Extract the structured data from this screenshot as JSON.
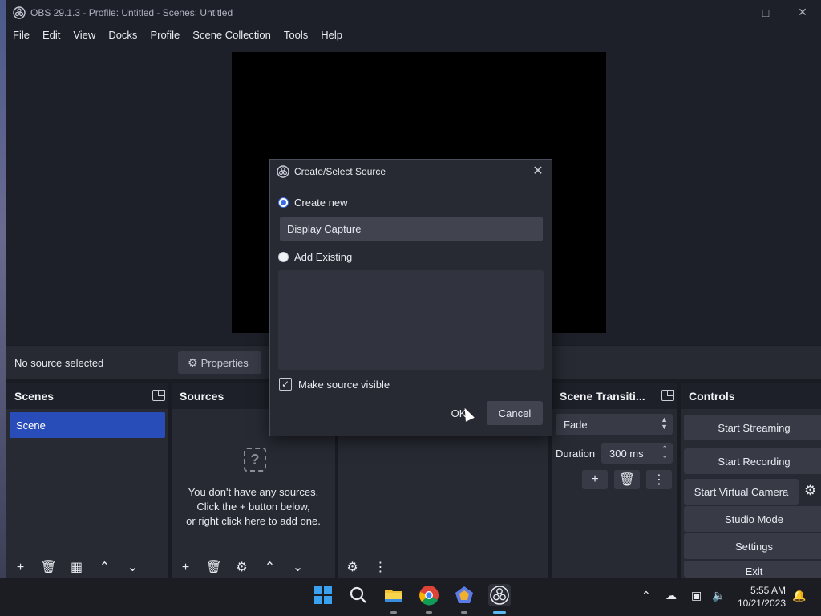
{
  "window": {
    "title": "OBS 29.1.3 - Profile: Untitled - Scenes: Untitled"
  },
  "menu": [
    "File",
    "Edit",
    "View",
    "Docks",
    "Profile",
    "Scene Collection",
    "Tools",
    "Help"
  ],
  "source_bar": {
    "no_source": "No source selected",
    "properties_label": "Properties"
  },
  "docks": {
    "scenes": {
      "title": "Scenes",
      "items": [
        "Scene"
      ]
    },
    "sources": {
      "title": "Sources",
      "empty_line1": "You don't have any sources.",
      "empty_line2": "Click the + button below,",
      "empty_line3": "or right click here to add one."
    },
    "transitions": {
      "title": "Scene Transiti...",
      "transition": "Fade",
      "duration_label": "Duration",
      "duration_value": "300 ms"
    },
    "controls": {
      "title": "Controls",
      "buttons": [
        "Start Streaming",
        "Start Recording",
        "Start Virtual Camera",
        "Studio Mode",
        "Settings",
        "Exit"
      ]
    }
  },
  "dialog": {
    "title": "Create/Select Source",
    "create_new_label": "Create new",
    "create_new_selected": true,
    "source_name": "Display Capture",
    "add_existing_label": "Add Existing",
    "make_visible_label": "Make source visible",
    "make_visible_checked": true,
    "ok_label": "OK",
    "cancel_label": "Cancel"
  },
  "taskbar": {
    "time": "5:55 AM",
    "date": "10/21/2023"
  },
  "colors": {
    "accent": "#284cb8",
    "panel": "#272a33",
    "background": "#1e2029"
  }
}
